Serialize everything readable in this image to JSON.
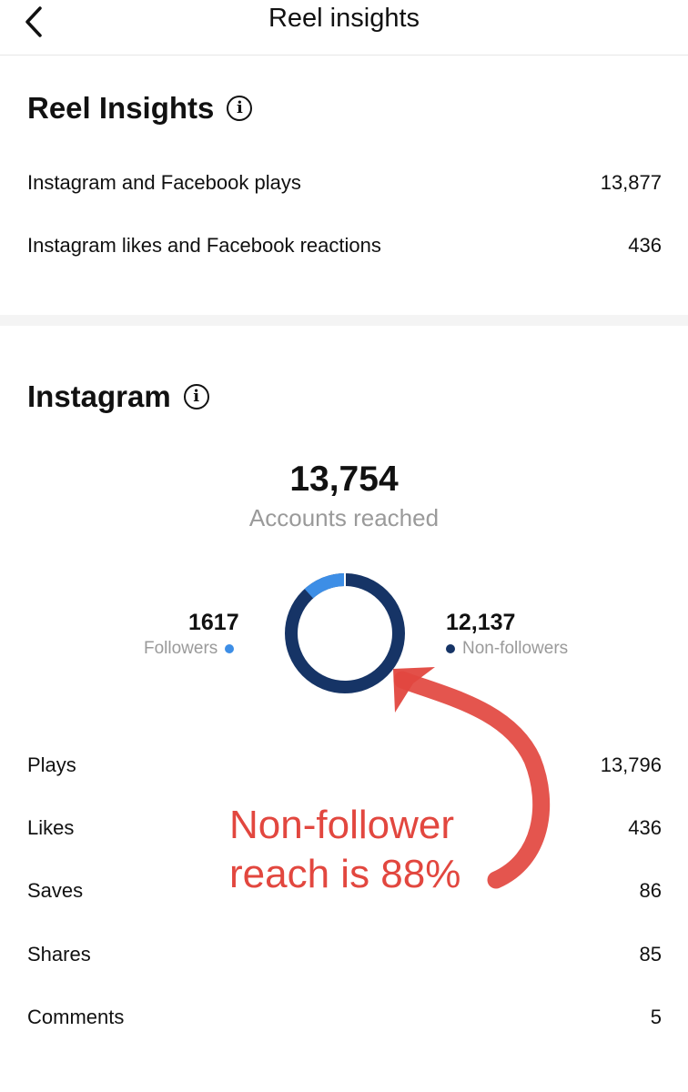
{
  "header": {
    "title": "Reel insights",
    "back_icon": "chevron-left-icon"
  },
  "reel_insights": {
    "title": "Reel Insights",
    "info_icon": "info-icon",
    "rows": [
      {
        "label": "Instagram and Facebook plays",
        "value": "13,877"
      },
      {
        "label": "Instagram likes and Facebook reactions",
        "value": "436"
      }
    ]
  },
  "instagram": {
    "title": "Instagram",
    "info_icon": "info-icon",
    "accounts_reached": {
      "value": "13,754",
      "label": "Accounts reached"
    },
    "followers": {
      "value": "1617",
      "label": "Followers",
      "color": "#3d8ee6"
    },
    "non_followers": {
      "value": "12,137",
      "label": "Non-followers",
      "color": "#163466"
    },
    "donut_fraction_followers": 0.1176,
    "rows": [
      {
        "label": "Plays",
        "value": "13,796"
      },
      {
        "label": "Likes",
        "value": "436"
      },
      {
        "label": "Saves",
        "value": "86"
      },
      {
        "label": "Shares",
        "value": "85"
      },
      {
        "label": "Comments",
        "value": "5"
      }
    ]
  },
  "annotation": {
    "line1": "Non-follower",
    "line2": "reach is 88%",
    "color": "#e2473f"
  }
}
